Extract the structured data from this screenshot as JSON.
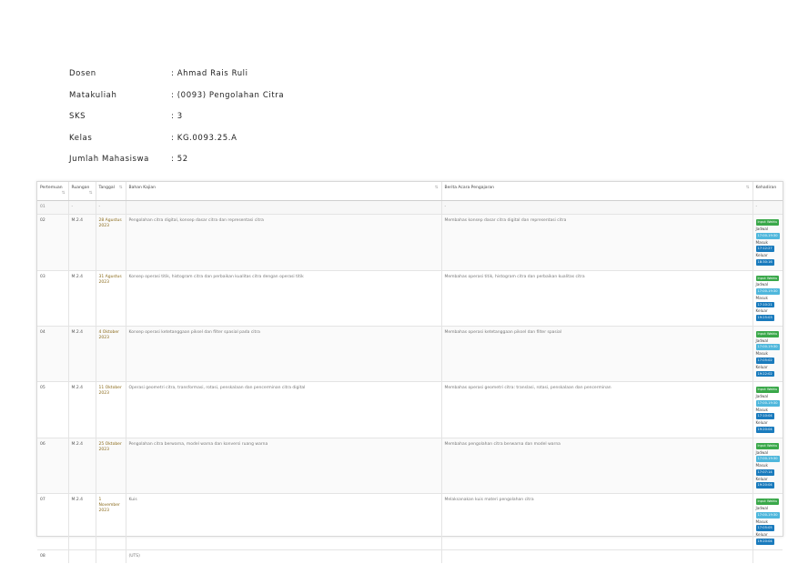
{
  "info": [
    {
      "label": "Dosen",
      "value": ": Ahmad Rais Ruli"
    },
    {
      "label": "Matakuliah",
      "value": ": (0093) Pengolahan Citra"
    },
    {
      "label": "SKS",
      "value": ": 3"
    },
    {
      "label": "Kelas",
      "value": ": KG.0093.25.A"
    },
    {
      "label": "Jumlah Mahasiswa",
      "value": ": 52"
    }
  ],
  "table": {
    "headers": [
      "Pertemuan",
      "Ruangan",
      "Tanggal",
      "Bahan Kajian",
      "Berita Acara Pengajaran",
      "Kehadiran"
    ],
    "filter": [
      "01",
      "-",
      "-",
      "",
      "-",
      "-"
    ],
    "rows": [
      {
        "no": "02",
        "ruang": "M.2.4",
        "tgl": "28 Agustus 2023",
        "bahan": "Pengolahan citra digital, konsep dasar citra dan representasi citra",
        "berita": "Membahas konsep dasar citra digital dan representasi citra",
        "input": "Input Waktu",
        "jadwal": "Jadwal",
        "jadwal_t": "17:00-19:30",
        "masuk": "Masuk",
        "masuk_t": "17:12:27",
        "keluar": "Keluar",
        "keluar_t": "18:30:16"
      },
      {
        "no": "03",
        "ruang": "M.2.4",
        "tgl": "31 Agustus 2023",
        "bahan": "Konsep operasi titik, histogram citra dan perbaikan kualitas citra dengan operasi titik",
        "berita": "Membahas operasi titik, histogram citra dan perbaikan kualitas citra",
        "input": "Input Waktu",
        "jadwal": "Jadwal",
        "jadwal_t": "17:00-19:30",
        "masuk": "Masuk",
        "masuk_t": "17:10:21",
        "keluar": "Keluar",
        "keluar_t": "19:25:03"
      },
      {
        "no": "04",
        "ruang": "M.2.4",
        "tgl": "4 Oktober 2023",
        "bahan": "Konsep operasi ketetanggaan piksel dan filter spasial pada citra",
        "berita": "Membahas operasi ketetanggaan piksel dan filter spasial",
        "input": "Input Waktu",
        "jadwal": "Jadwal",
        "jadwal_t": "17:00-19:30",
        "masuk": "Masuk",
        "masuk_t": "17:05:02",
        "keluar": "Keluar",
        "keluar_t": "19:22:02"
      },
      {
        "no": "05",
        "ruang": "M.2.4",
        "tgl": "11 Oktober 2023",
        "bahan": "Operasi geometri citra, transformasi, rotasi, penskalaan dan pencerminan citra digital",
        "berita": "Membahas operasi geometri citra: translasi, rotasi, penskalaan dan pencerminan",
        "input": "Input Waktu",
        "jadwal": "Jadwal",
        "jadwal_t": "17:00-19:30",
        "masuk": "Masuk",
        "masuk_t": "17:10:04",
        "keluar": "Keluar",
        "keluar_t": "19:20:04"
      },
      {
        "no": "06",
        "ruang": "M.2.4",
        "tgl": "25 Oktober 2023",
        "bahan": "Pengolahan citra berwarna, model warna dan konversi ruang warna",
        "berita": "Membahas pengolahan citra berwarna dan model warna",
        "input": "Input Waktu",
        "jadwal": "Jadwal",
        "jadwal_t": "17:00-19:30",
        "masuk": "Masuk",
        "masuk_t": "17:07:14",
        "keluar": "Keluar",
        "keluar_t": "19:20:04"
      },
      {
        "no": "07",
        "ruang": "M.2.4",
        "tgl": "1 November 2023",
        "bahan": "Kuis",
        "berita": "Melaksanakan kuis materi pengolahan citra",
        "input": "Input Waktu",
        "jadwal": "Jadwal",
        "jadwal_t": "17:00-19:30",
        "masuk": "Masuk",
        "masuk_t": "17:05:05",
        "keluar": "Keluar",
        "keluar_t": "19:20:04"
      }
    ],
    "last": {
      "no": "08",
      "bahan": "(UTS)"
    }
  }
}
